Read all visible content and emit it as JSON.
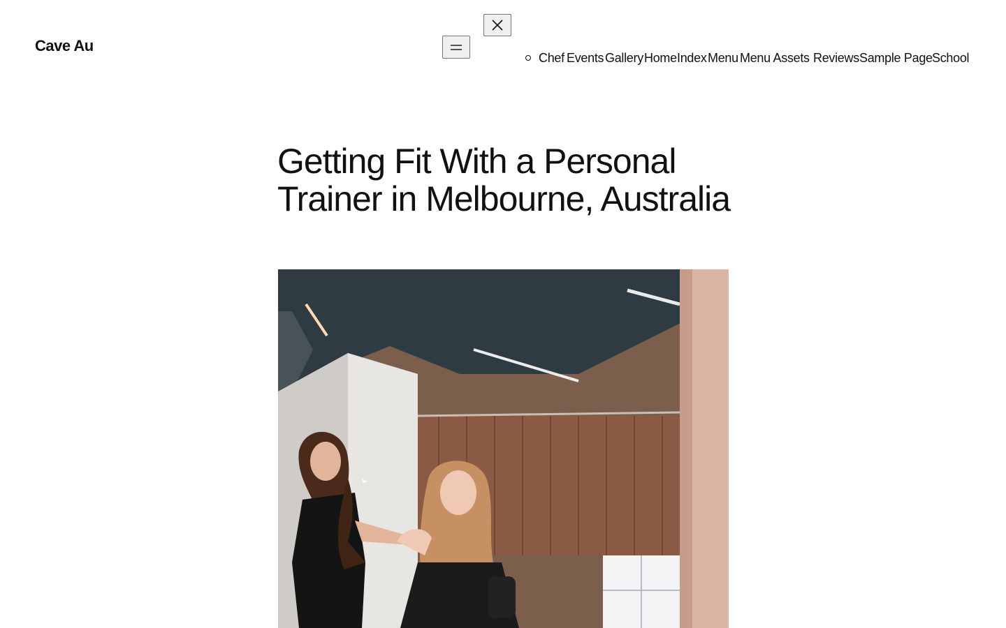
{
  "site": {
    "title": "Cave Au"
  },
  "header": {
    "menu_icon": "hamburger-icon",
    "close_icon": "close-icon",
    "nav_items": [
      "Chef",
      "Events",
      "Gallery",
      "Home",
      "Index",
      "Menu",
      "Menu Assets",
      "Reviews",
      "Sample Page",
      "School"
    ]
  },
  "post": {
    "title": "Getting Fit With a Personal Trainer in Melbourne, Australia",
    "image_description_icon": "photo"
  },
  "colors": {
    "background": "#ffffff",
    "text": "#111111",
    "ceiling": "#2d3a40",
    "blinds": "#8a5a44"
  }
}
